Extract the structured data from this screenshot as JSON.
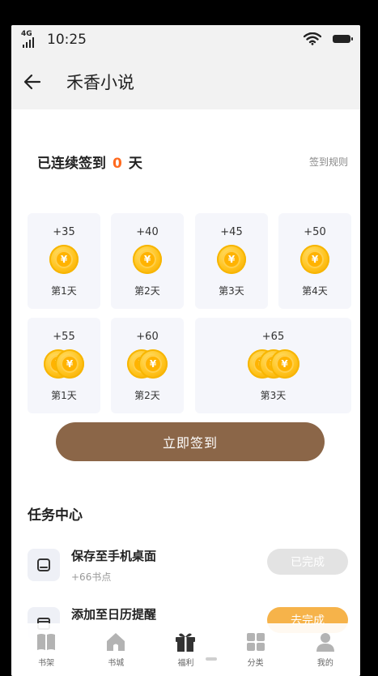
{
  "status_bar": {
    "network": "4G",
    "time": "10:25"
  },
  "header": {
    "title": "禾香小说"
  },
  "sign_in": {
    "streak_prefix": "已连续签到",
    "streak_count": "0",
    "streak_suffix": "天",
    "rules_link": "签到规则",
    "days": [
      {
        "bonus": "+35",
        "label": "第1天",
        "coins": 1
      },
      {
        "bonus": "+40",
        "label": "第2天",
        "coins": 1
      },
      {
        "bonus": "+45",
        "label": "第3天",
        "coins": 1
      },
      {
        "bonus": "+50",
        "label": "第4天",
        "coins": 1
      },
      {
        "bonus": "+55",
        "label": "第1天",
        "coins": 2
      },
      {
        "bonus": "+60",
        "label": "第2天",
        "coins": 2
      },
      {
        "bonus": "+65",
        "label": "第3天",
        "coins": 3
      }
    ],
    "coin_symbol": "¥",
    "button_label": "立即签到"
  },
  "tasks": {
    "title": "任务中心",
    "items": [
      {
        "name": "保存至手机桌面",
        "reward": "+66书点",
        "status": "已完成",
        "icon": "save-icon"
      },
      {
        "name": "添加至日历提醒",
        "reward": "",
        "status": "去完成",
        "icon": "calendar-icon"
      }
    ]
  },
  "tab_bar": {
    "items": [
      {
        "label": "书架",
        "icon": "bookshelf-icon"
      },
      {
        "label": "书城",
        "icon": "bookstore-icon"
      },
      {
        "label": "福利",
        "icon": "gift-icon"
      },
      {
        "label": "分类",
        "icon": "category-icon"
      },
      {
        "label": "我的",
        "icon": "profile-icon"
      }
    ]
  },
  "colors": {
    "accent": "#8b6648",
    "streak_count": "#ff6a1f",
    "coin": "#ffc21a",
    "done_button": "#e3e3e3",
    "todo_button": "#f6b34a"
  }
}
